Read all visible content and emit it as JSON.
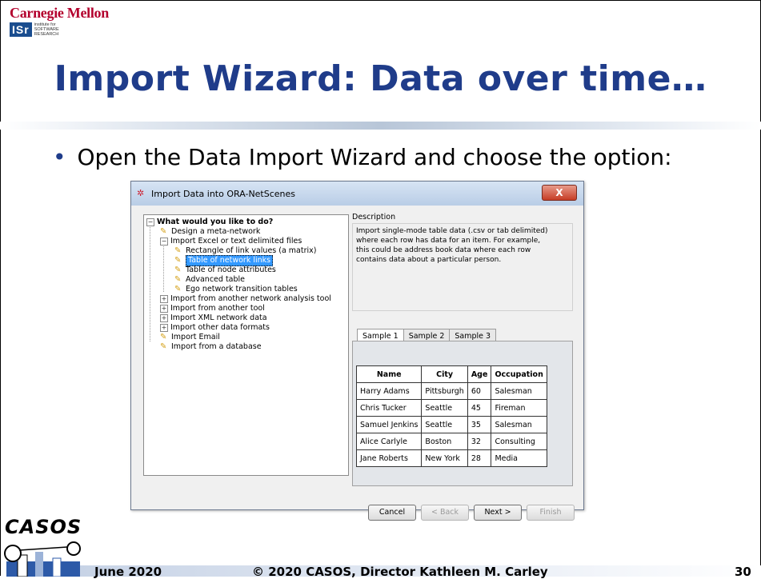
{
  "header": {
    "cmu_logo": "Carnegie Mellon",
    "isr_logo": "ISr",
    "isr_sub": [
      "institute for",
      "SOFTWARE",
      "RESEARCH"
    ]
  },
  "slide": {
    "title": "Import Wizard: Data over time…",
    "bullet": "Open the Data Import Wizard and choose the option:"
  },
  "dialog": {
    "title": "Import Data into ORA-NetScenes",
    "close_label": "X",
    "tree": {
      "root": "What would you like to do?",
      "items": [
        "Design a meta-network",
        "Import Excel or text delimited files",
        "Rectangle of link values (a matrix)",
        "Table of network links",
        "Table of node attributes",
        "Advanced table",
        "Ego network transition tables",
        "Import from another network analysis tool",
        "Import from another tool",
        "Import XML network data",
        "Import other data formats",
        "Import Email",
        "Import from a database"
      ]
    },
    "description": {
      "label": "Description",
      "lines": [
        "Import single-mode table data (.csv or tab delimited)",
        "where each row has data for an item. For example,",
        "this could be address book data where each row",
        "contains data about a particular person."
      ]
    },
    "tabs": [
      "Sample 1",
      "Sample 2",
      "Sample 3"
    ],
    "sample_table": {
      "headers": [
        "Name",
        "City",
        "Age",
        "Occupation"
      ],
      "rows": [
        [
          "Harry Adams",
          "Pittsburgh",
          "60",
          "Salesman"
        ],
        [
          "Chris Tucker",
          "Seattle",
          "45",
          "Fireman"
        ],
        [
          "Samuel Jenkins",
          "Seattle",
          "35",
          "Salesman"
        ],
        [
          "Alice Carlyle",
          "Boston",
          "32",
          "Consulting"
        ],
        [
          "Jane Roberts",
          "New York",
          "28",
          "Media"
        ]
      ]
    },
    "buttons": {
      "cancel": "Cancel",
      "back": "< Back",
      "next": "Next >",
      "finish": "Finish"
    }
  },
  "footer": {
    "logo": "CASOS",
    "date": "June 2020",
    "copyright": "© 2020 CASOS, Director Kathleen M. Carley",
    "page": "30"
  }
}
